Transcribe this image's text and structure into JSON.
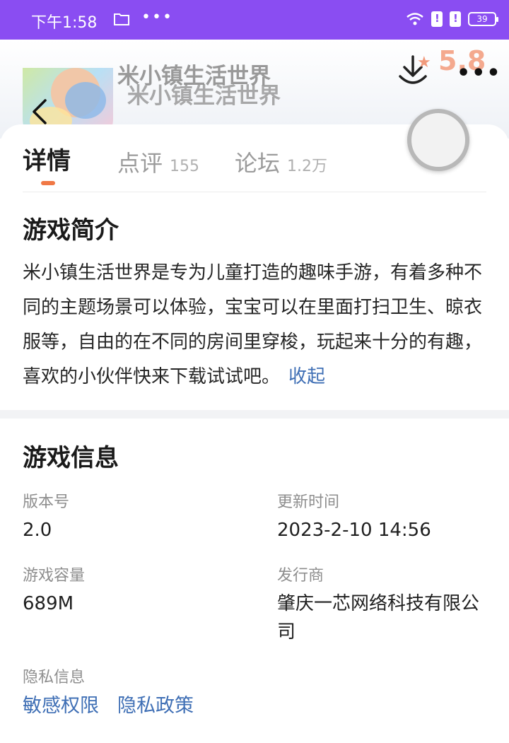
{
  "status_bar": {
    "time": "下午1:58",
    "dots": "•••",
    "battery": "39"
  },
  "header": {
    "app_title": "米小镇生活世界",
    "rating": "5.8"
  },
  "tabs": [
    {
      "label": "详情",
      "count": ""
    },
    {
      "label": "点评",
      "count": "155"
    },
    {
      "label": "论坛",
      "count": "1.2万"
    }
  ],
  "intro": {
    "title": "游戏简介",
    "text": "米小镇生活世界是专为儿童打造的趣味手游，有着多种不同的主题场景可以体验，宝宝可以在里面打扫卫生、晾衣服等，自由的在不同的房间里穿梭，玩起来十分的有趣，喜欢的小伙伴快来下载试试吧。",
    "collapse_label": "收起"
  },
  "info": {
    "title": "游戏信息",
    "version_label": "版本号",
    "version_value": "2.0",
    "update_label": "更新时间",
    "update_value": "2023-2-10 14:56",
    "size_label": "游戏容量",
    "size_value": "689M",
    "publisher_label": "发行商",
    "publisher_value": "肇庆一芯网络科技有限公司",
    "privacy_label": "隐私信息",
    "permission_link": "敏感权限",
    "policy_link": "隐私政策"
  },
  "colors": {
    "status_bar": "#8a4df2",
    "accent": "#f07845",
    "link": "#3f6fb5",
    "rating": "#f4a98e"
  }
}
